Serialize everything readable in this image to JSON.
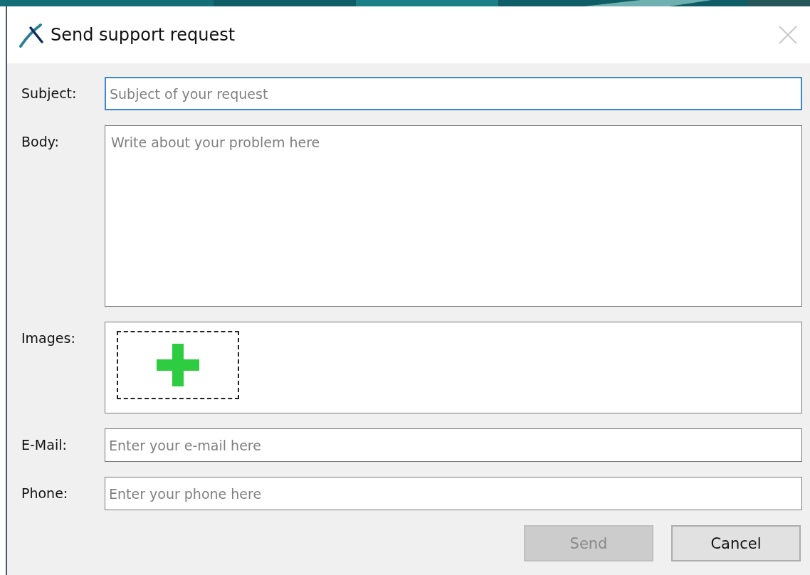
{
  "window": {
    "title": "Send support request"
  },
  "fields": [
    {
      "kind": "line",
      "label": "Subject:",
      "placeholder": "Subject of your request",
      "focused": true
    },
    {
      "kind": "area",
      "label": "Body:",
      "placeholder": "Write about your problem here",
      "focused": false
    },
    {
      "kind": "images",
      "label": "Images:"
    },
    {
      "kind": "line",
      "label": "E-Mail:",
      "placeholder": "Enter your e-mail here",
      "focused": false
    },
    {
      "kind": "line",
      "label": "Phone:",
      "placeholder": "Enter your phone here",
      "focused": false
    }
  ],
  "buttons": [
    {
      "label": "Send",
      "disabled": true
    },
    {
      "label": "Cancel",
      "disabled": false
    }
  ]
}
